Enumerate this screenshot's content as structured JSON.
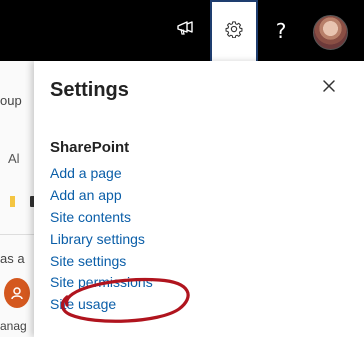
{
  "topbar": {
    "background": "#000000",
    "icons": [
      "megaphone-icon",
      "gear-icon",
      "help-icon",
      "avatar"
    ],
    "help_glyph": "?"
  },
  "background_page": {
    "text_1": "oup",
    "text_2": "Al",
    "text_3": "as a",
    "text_4": "anag"
  },
  "panel": {
    "title": "Settings",
    "section_title": "SharePoint",
    "items": [
      {
        "label": "Add a page"
      },
      {
        "label": "Add an app"
      },
      {
        "label": "Site contents"
      },
      {
        "label": "Library settings"
      },
      {
        "label": "Site settings"
      },
      {
        "label": "Site permissions"
      },
      {
        "label": "Site usage"
      }
    ],
    "link_color": "#0a5ea8",
    "highlight_color": "#b0141e"
  }
}
